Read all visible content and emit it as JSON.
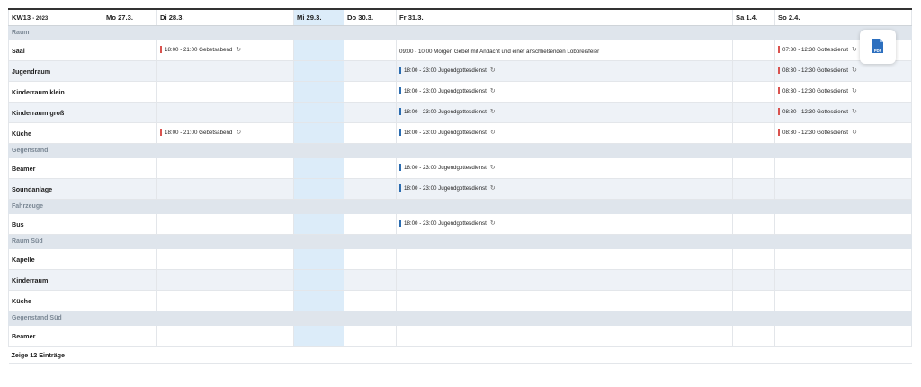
{
  "header": {
    "week": "KW13",
    "year": "- 2023",
    "days": [
      "Mo 27.3.",
      "Di 28.3.",
      "Mi 29.3.",
      "Do 30.3.",
      "Fr 31.3.",
      "Sa 1.4.",
      "So 2.4."
    ]
  },
  "groups": [
    {
      "label": "Raum"
    },
    {
      "label": "Gegenstand"
    },
    {
      "label": "Fahrzeuge"
    },
    {
      "label": "Raum Süd"
    },
    {
      "label": "Gegenstand Süd"
    }
  ],
  "rows": {
    "saal": {
      "name": "Saal",
      "tue": "18:00 - 21:00 Gebetsabend",
      "fri": "09:00 - 10:00 Morgen Gebet mit Andacht und einer anschließenden Lobpreisfeier",
      "sun": "07:30 - 12:30 Gottesdienst"
    },
    "jugendraum": {
      "name": "Jugendraum",
      "fri": "18:00 - 23:00 Jugendgottesdienst",
      "sun": "08:30 - 12:30 Gottesdienst"
    },
    "kinderraum_klein": {
      "name": "Kinderraum klein",
      "fri": "18:00 - 23:00 Jugendgottesdienst",
      "sun": "08:30 - 12:30 Gottesdienst"
    },
    "kinderraum_gross": {
      "name": "Kinderraum groß",
      "fri": "18:00 - 23:00 Jugendgottesdienst",
      "sun": "08:30 - 12:30 Gottesdienst"
    },
    "kueche": {
      "name": "Küche",
      "tue": "18:00 - 21:00 Gebetsabend",
      "fri": "18:00 - 23:00 Jugendgottesdienst",
      "sun": "08:30 - 12:30 Gottesdienst"
    },
    "beamer": {
      "name": "Beamer",
      "fri": "18:00 - 23:00 Jugendgottesdienst"
    },
    "soundanlage": {
      "name": "Soundanlage",
      "fri": "18:00 - 23:00 Jugendgottesdienst"
    },
    "bus": {
      "name": "Bus",
      "fri": "18:00 - 23:00 Jugendgottesdienst"
    },
    "kapelle": {
      "name": "Kapelle"
    },
    "kinderraum_sued": {
      "name": "Kinderraum"
    },
    "kueche_sued": {
      "name": "Küche"
    },
    "beamer_sued": {
      "name": "Beamer"
    }
  },
  "footer": {
    "text": "Zeige 12 Einträge"
  },
  "pdf_button": {
    "icon": "pdf-file-icon"
  },
  "colors": {
    "today": "#dcecf9",
    "group_bg": "#dfe5ec",
    "alt_row": "#eef2f7",
    "event_red": "#d9534f",
    "event_blue": "#2b6cb0",
    "pdf_blue": "#2c6fbf"
  }
}
